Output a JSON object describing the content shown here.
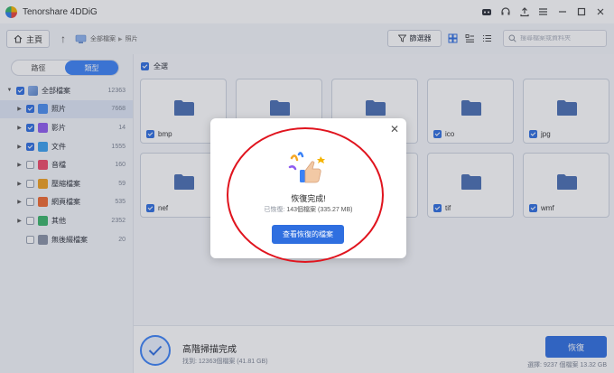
{
  "app": {
    "title": "Tenorshare 4DDiG"
  },
  "nav": {
    "home_label": "主頁",
    "breadcrumb": [
      "全部檔案",
      "照片"
    ],
    "filter_label": "篩選器",
    "search_placeholder": "搜尋檔案或資料夾"
  },
  "sidebar": {
    "tabs": [
      {
        "label": "路徑",
        "active": false
      },
      {
        "label": "類型",
        "active": true
      }
    ],
    "tree": [
      {
        "label": "全部檔案",
        "count": "12363",
        "checked": true,
        "expanded": true,
        "level": 0,
        "icon": "all-files-icon"
      },
      {
        "label": "照片",
        "count": "7668",
        "checked": true,
        "selected": true,
        "level": 1,
        "icon": "photo-icon",
        "color": "#4a8df0"
      },
      {
        "label": "影片",
        "count": "14",
        "checked": true,
        "level": 1,
        "icon": "video-icon",
        "color": "#8f5cf0"
      },
      {
        "label": "文件",
        "count": "1555",
        "checked": true,
        "level": 1,
        "icon": "document-icon",
        "color": "#3aa0f0"
      },
      {
        "label": "音檔",
        "count": "160",
        "checked": false,
        "level": 1,
        "icon": "audio-icon",
        "color": "#f04a6a"
      },
      {
        "label": "壓縮檔案",
        "count": "59",
        "checked": false,
        "level": 1,
        "icon": "archive-icon",
        "color": "#f0a020"
      },
      {
        "label": "網頁檔案",
        "count": "535",
        "checked": false,
        "level": 1,
        "icon": "web-icon",
        "color": "#f06a30"
      },
      {
        "label": "其他",
        "count": "2352",
        "checked": false,
        "level": 1,
        "icon": "other-icon",
        "color": "#3ab56a"
      },
      {
        "label": "無後綴檔案",
        "count": "20",
        "checked": false,
        "level": 1,
        "icon": "no-extension-icon",
        "color": "#8a93a6"
      }
    ]
  },
  "main": {
    "select_all_label": "全選",
    "tiles": [
      {
        "label": "bmp",
        "checked": true
      },
      {
        "label": "",
        "checked": false
      },
      {
        "label": "",
        "checked": false
      },
      {
        "label": "ico",
        "checked": true
      },
      {
        "label": "jpg",
        "checked": true
      },
      {
        "label": "nef",
        "checked": true
      },
      {
        "label": "",
        "checked": false
      },
      {
        "label": "",
        "checked": false
      },
      {
        "label": "tif",
        "checked": true
      },
      {
        "label": "wmf",
        "checked": true
      }
    ]
  },
  "status": {
    "title": "高階掃描完成",
    "found_text": "找到: 12363個檔案 (41.81 GB)",
    "recover_label": "恢復",
    "selected_text": "選擇: 9237 個檔案 13.32 GB"
  },
  "modal": {
    "title": "恢復完成!",
    "recovered_label": "已恢復:",
    "recovered_value": "143個檔案 (335.27 MB)",
    "button_label": "查看恢復的檔案"
  },
  "colors": {
    "accent": "#2f6fe0",
    "annotation": "#e0141e"
  }
}
